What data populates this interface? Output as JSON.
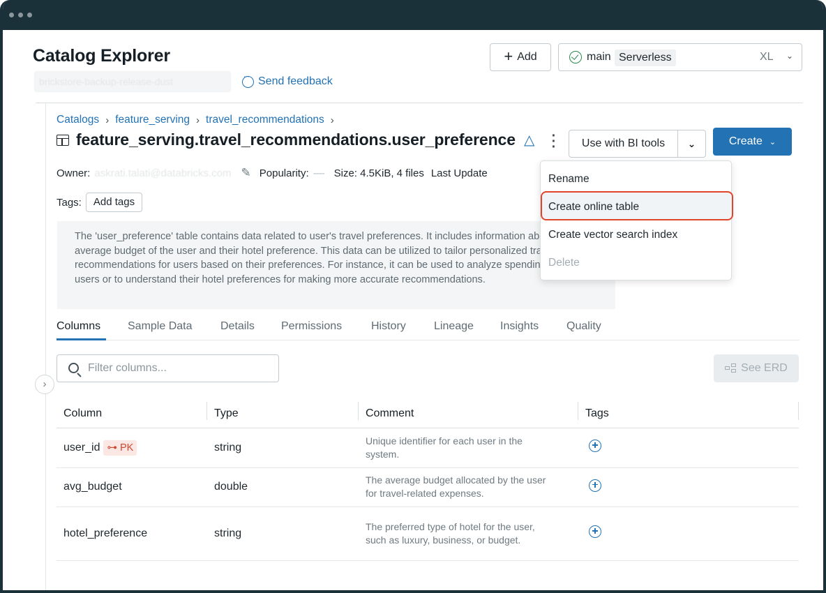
{
  "window": {
    "title": "Catalog Explorer"
  },
  "header": {
    "workspace_blurred": "brickstore-backup-release-dust",
    "feedback_label": "Send feedback",
    "add_label": "Add",
    "warehouse": {
      "name": "main",
      "type": "Serverless",
      "size": "XL"
    }
  },
  "breadcrumb": [
    "Catalogs",
    "feature_serving",
    "travel_recommendations"
  ],
  "table": {
    "title": "feature_serving.travel_recommendations.user_preference",
    "bi_tools_label": "Use with BI tools",
    "create_label": "Create",
    "meta": {
      "owner_label": "Owner:",
      "owner_value": "askrati.talati@databricks.com",
      "popularity_label": "Popularity:",
      "popularity_value": "----",
      "size": "Size: 4.5KiB, 4 files",
      "last_updated": "Last Update"
    },
    "tags_label": "Tags:",
    "add_tags_label": "Add tags",
    "description": "The 'user_preference' table contains data related to user's travel preferences. It includes information about the average budget of the user and their hotel preference. This data can be utilized to tailor personalized travel recommendations for users based on their preferences. For instance, it can be used to analyze spending patterns of users or to understand their hotel preferences for making more accurate recommendations."
  },
  "menu": {
    "items": [
      {
        "label": "Rename",
        "disabled": false
      },
      {
        "label": "Create online table",
        "disabled": false,
        "highlighted": true
      },
      {
        "label": "Create vector search index",
        "disabled": false
      },
      {
        "label": "Delete",
        "disabled": true
      }
    ]
  },
  "tabs": [
    "Columns",
    "Sample Data",
    "Details",
    "Permissions",
    "History",
    "Lineage",
    "Insights",
    "Quality"
  ],
  "filter": {
    "placeholder": "Filter columns..."
  },
  "erd_label": "See ERD",
  "columns_table": {
    "headers": [
      "Column",
      "Type",
      "Comment",
      "Tags"
    ],
    "rows": [
      {
        "column": "user_id",
        "badge": "PK",
        "type": "string",
        "comment": "Unique identifier for each user in the system."
      },
      {
        "column": "avg_budget",
        "type": "double",
        "comment": "The average budget allocated by the user for travel-related expenses."
      },
      {
        "column": "hotel_preference",
        "type": "string",
        "comment": "The preferred type of hotel for the user, such as luxury, business, or budget."
      }
    ]
  },
  "colors": {
    "accent": "#2272b4",
    "titlebar": "#1b3139",
    "highlight_border": "#e0442a",
    "pk_badge": "#d0482e"
  },
  "icons": [
    "table-icon",
    "delta-icon",
    "kebab-icon",
    "check-circle-icon",
    "plus-icon",
    "chevron-down-icon",
    "feedback-icon",
    "pencil-icon",
    "search-icon",
    "erd-icon",
    "key-icon",
    "add-tag-icon",
    "chevron-right-icon"
  ]
}
